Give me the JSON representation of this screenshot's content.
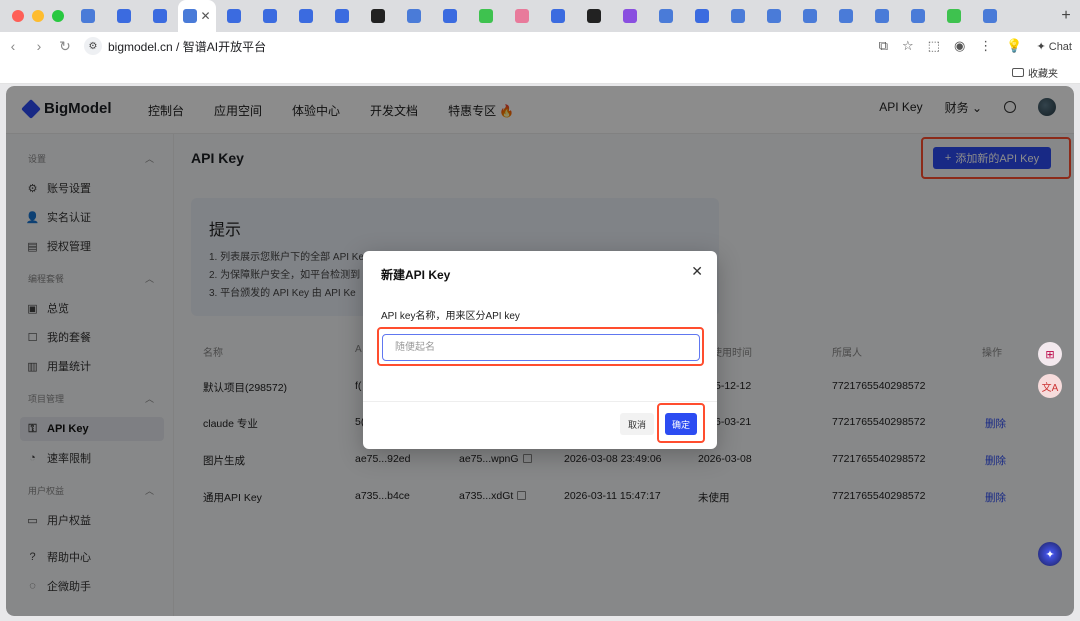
{
  "browser": {
    "url_host": "bigmodel.cn",
    "url_sep": " / ",
    "url_title": "智谱AI开放平台",
    "chat_label": "Chat",
    "bookmarks_folder": "收藏夹",
    "tab_favicon_colors": [
      "#4a7bd8",
      "#3b6be0",
      "#3b6be0",
      "#4a7bd8",
      "#3b6be0",
      "#3b6be0",
      "#3b6be0",
      "#3b6be0",
      "#222",
      "#4a7bd8",
      "#3b6be0",
      "#3ec24f",
      "#e87a9b",
      "#3b6be0",
      "#222",
      "#8a4fe0",
      "#4a7bd8",
      "#3b6be0",
      "#4a7bd8",
      "#4a7bd8",
      "#4a7bd8",
      "#4a7bd8",
      "#4a7bd8",
      "#4a7bd8",
      "#3ec24f",
      "#4a7bd8"
    ]
  },
  "topnav": {
    "brand": "BigModel",
    "links": [
      "控制台",
      "应用空间",
      "体验中心",
      "开发文档",
      "特惠专区 🔥"
    ],
    "api_key": "API Key",
    "finance": "财务",
    "finance_chevron": "⌄"
  },
  "sidebar": {
    "sections": {
      "settings": "设置",
      "coding": "编程套餐",
      "project": "项目管理",
      "rights": "用户权益"
    },
    "items": {
      "account": "账号设置",
      "realname": "实名认证",
      "auth": "授权管理",
      "overview": "总览",
      "mypackage": "我的套餐",
      "usage": "用量统计",
      "apikey": "API Key",
      "ratelimit": "速率限制",
      "userrights": "用户权益",
      "help": "帮助中心",
      "assistant": "企微助手"
    }
  },
  "main": {
    "title": "API Key",
    "add_button": "添加新的API Key",
    "add_icon": "+",
    "tip": {
      "title": "提示",
      "lines": [
        "1. 列表展示您账户下的全部 API Key",
        "2. 为保障账户安全，如平台检测到",
        "3. 平台颁发的 API Key 由 API Ke"
      ]
    },
    "table": {
      "headers": {
        "name": "名称",
        "key": "A",
        "last_used": "使用时间",
        "owner": "所属人",
        "actions": "操作"
      },
      "rows": [
        {
          "name": "默认项目(298572)",
          "key": "f(",
          "secret": "",
          "created": "",
          "last_used": "5-12-12",
          "owner": "7721765540298572",
          "action": ""
        },
        {
          "name": "claude 专业",
          "key": "5(",
          "secret": "",
          "created": "",
          "last_used": "6-03-21",
          "owner": "7721765540298572",
          "action": "删除"
        },
        {
          "name": "图片生成",
          "key": "ae75...92ed",
          "secret": "ae75...wpnG",
          "created": "2026-03-08 23:49:06",
          "last_used": "2026-03-08",
          "owner": "7721765540298572",
          "action": "删除"
        },
        {
          "name": "通用API Key",
          "key": "a735...b4ce",
          "secret": "a735...xdGt",
          "created": "2026-03-11 15:47:17",
          "last_used": "未使用",
          "owner": "7721765540298572",
          "action": "删除"
        }
      ]
    }
  },
  "modal": {
    "title": "新建API Key",
    "close_icon": "✕",
    "label": "API key名称，用来区分API key",
    "placeholder": "随便起名",
    "value": "",
    "cancel": "取消",
    "confirm": "确定"
  },
  "colors": {
    "accent": "#2c4cf2",
    "highlight": "#ff4d2e"
  }
}
